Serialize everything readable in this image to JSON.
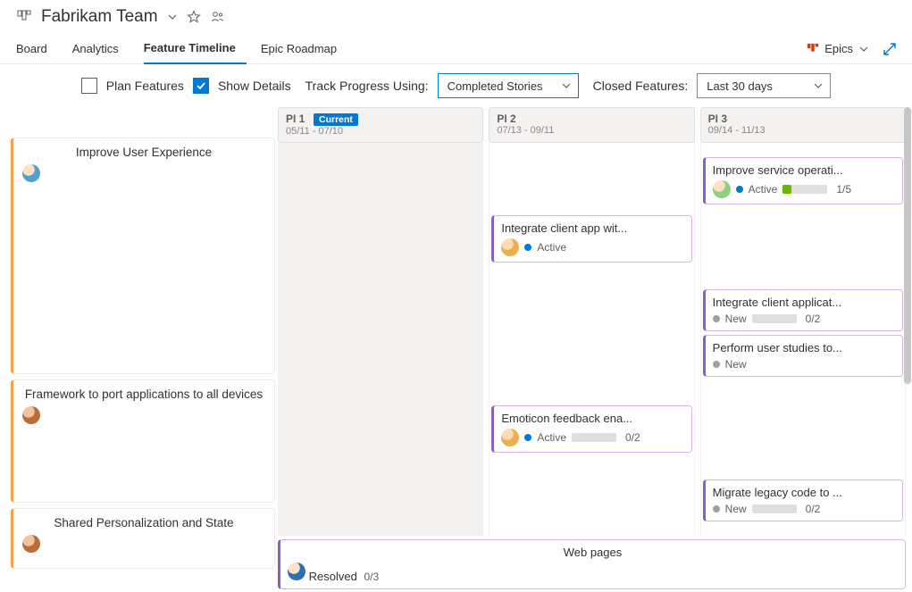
{
  "header": {
    "team_name": "Fabrikam Team"
  },
  "tabs": {
    "board": "Board",
    "analytics": "Analytics",
    "feature_timeline": "Feature Timeline",
    "epic_roadmap": "Epic Roadmap",
    "active": "feature_timeline",
    "view_selector": "Epics"
  },
  "controls": {
    "plan_features_label": "Plan Features",
    "plan_features_checked": false,
    "show_details_label": "Show Details",
    "show_details_checked": true,
    "track_progress_label": "Track Progress Using:",
    "track_progress_value": "Completed Stories",
    "closed_features_label": "Closed Features:",
    "closed_features_value": "Last 30 days"
  },
  "columns": [
    {
      "name": "PI 1",
      "dates": "05/11 - 07/10",
      "current": true,
      "badge": "Current"
    },
    {
      "name": "PI 2",
      "dates": "07/13 - 09/11",
      "current": false
    },
    {
      "name": "PI 3",
      "dates": "09/14 - 11/13",
      "current": false
    }
  ],
  "epics": [
    {
      "title": "Improve User Experience",
      "avatar": "a1",
      "rows": [
        {
          "col": 2,
          "feature": {
            "title": "Improve service operati...",
            "state": "Active",
            "state_color": "blue",
            "avatar": "a3",
            "progress_done": 1,
            "progress_total": 5,
            "progress_text": "1/5"
          }
        },
        {
          "col": 1,
          "feature": {
            "title": "Integrate client app wit...",
            "state": "Active",
            "state_color": "blue",
            "avatar": "a2"
          }
        },
        {
          "col": 2,
          "feature": {
            "title": "Integrate client applicat...",
            "state": "New",
            "state_color": "gray",
            "progress_done": 0,
            "progress_total": 2,
            "progress_text": "0/2"
          }
        },
        {
          "col": 2,
          "feature": {
            "title": "Perform user studies to...",
            "state": "New",
            "state_color": "gray"
          }
        }
      ]
    },
    {
      "title": "Framework to port applications to all devices",
      "avatar": "a4",
      "rows": [
        {
          "col": 1,
          "feature": {
            "title": "Emoticon feedback ena...",
            "state": "Active",
            "state_color": "blue",
            "avatar": "a2",
            "progress_done": 0,
            "progress_total": 2,
            "progress_text": "0/2"
          }
        },
        {
          "col": 2,
          "feature": {
            "title": "Migrate legacy code to ...",
            "state": "New",
            "state_color": "gray",
            "progress_done": 0,
            "progress_total": 2,
            "progress_text": "0/2"
          }
        }
      ]
    },
    {
      "title": "Shared Personalization and State",
      "avatar": "a4",
      "wide_feature": {
        "title": "Web pages",
        "state": "Resolved",
        "state_color": "blue",
        "avatar": "a5",
        "progress_done": 0,
        "progress_total": 3,
        "progress_text": "0/3"
      }
    }
  ]
}
